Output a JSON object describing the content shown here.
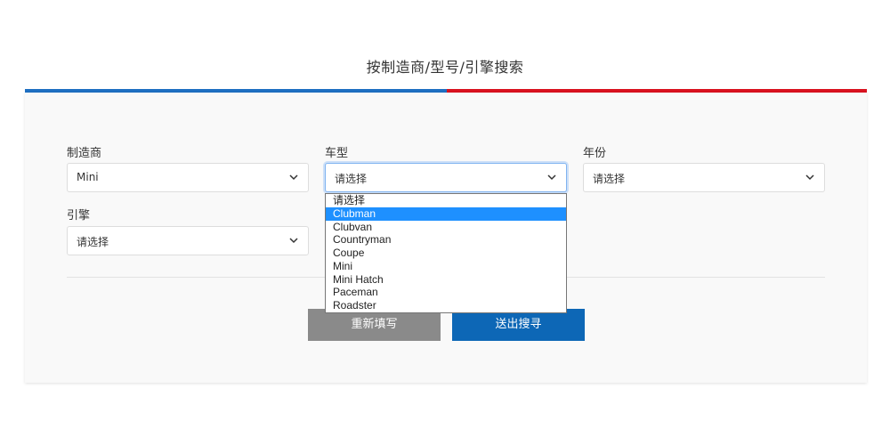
{
  "header": {
    "title": "按制造商/型号/引擎搜索"
  },
  "colors": {
    "bar_left": "#1e6fc2",
    "bar_right": "#d9121f",
    "reset_button_bg": "#8a8a8a",
    "submit_button_bg": "#0d67b6",
    "option_highlight_bg": "#1e90ff"
  },
  "form": {
    "manufacturer": {
      "label": "制造商",
      "value": "Mini",
      "icon": "chevron-down-icon"
    },
    "model": {
      "label": "车型",
      "value": "请选择",
      "icon": "chevron-down-icon",
      "options": [
        "请选择",
        "Clubman",
        "Clubvan",
        "Countryman",
        "Coupe",
        "Mini",
        "Mini Hatch",
        "Paceman",
        "Roadster"
      ],
      "highlighted_option": "Clubman"
    },
    "year": {
      "label": "年份",
      "value": "请选择",
      "icon": "chevron-down-icon"
    },
    "engine": {
      "label": "引擎",
      "value": "请选择",
      "icon": "chevron-down-icon"
    }
  },
  "buttons": {
    "reset_label": "重新填写",
    "submit_label": "送出搜寻"
  }
}
